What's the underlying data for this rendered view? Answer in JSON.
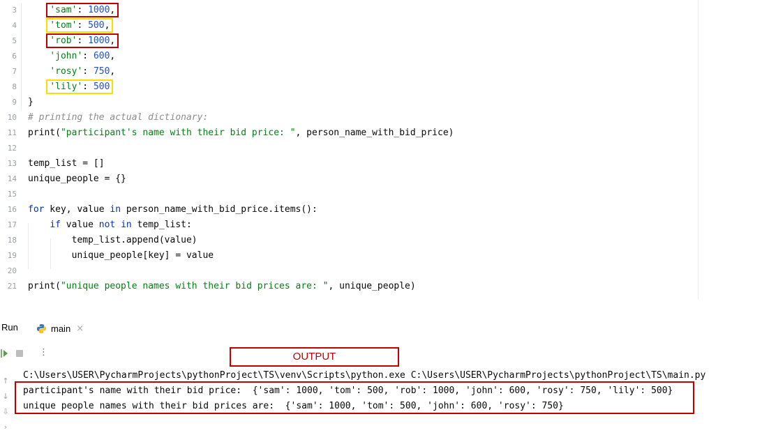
{
  "editor": {
    "line_numbers": [
      "3",
      "4",
      "5",
      "6",
      "7",
      "8",
      "9",
      "10",
      "11",
      "12",
      "13",
      "14",
      "15",
      "16",
      "17",
      "18",
      "19",
      "20",
      "21"
    ],
    "dict_entries": [
      {
        "key": "'sam'",
        "sep": ": ",
        "value": "1000",
        "end": ",",
        "highlight": "red"
      },
      {
        "key": "'tom'",
        "sep": ": ",
        "value": "500",
        "end": ",",
        "highlight": "yellow"
      },
      {
        "key": "'rob'",
        "sep": ": ",
        "value": "1000",
        "end": ",",
        "highlight": "red"
      },
      {
        "key": "'john'",
        "sep": ": ",
        "value": "600",
        "end": ",",
        "highlight": "none"
      },
      {
        "key": "'rosy'",
        "sep": ": ",
        "value": "750",
        "end": ",",
        "highlight": "none"
      },
      {
        "key": "'lily'",
        "sep": ": ",
        "value": "500",
        "end": "",
        "highlight": "yellow"
      }
    ],
    "closing_brace": "}",
    "comment": "# printing the actual dictionary:",
    "print1_fn": "print(",
    "print1_str": "\"participant's name with their bid price: \"",
    "print1_rest": ", person_name_with_bid_price)",
    "temp_list_line": "temp_list = []",
    "unique_people_line": "unique_people = {}",
    "for_kw": "for",
    "for_mid": " key, value ",
    "in_kw": "in",
    "for_rest": " person_name_with_bid_price.items():",
    "if_kw": "if",
    "if_mid": " value ",
    "not_kw": "not",
    "in_kw2": "in",
    "if_rest": " temp_list:",
    "append_line": "temp_list.append(value)",
    "assign_line": "unique_people[key] = value",
    "print2_fn": "print(",
    "print2_str": "\"unique people names with their bid prices are: \"",
    "print2_rest": ", unique_people)"
  },
  "run_panel": {
    "title": "Run",
    "tab_label": "main",
    "tab_close": "×",
    "more_icon": "⋮",
    "output_label": "OUTPUT",
    "console_lines": [
      "C:\\Users\\USER\\PycharmProjects\\pythonProject\\TS\\venv\\Scripts\\python.exe C:\\Users\\USER\\PycharmProjects\\pythonProject\\TS\\main.py",
      "participant's name with their bid price:  {'sam': 1000, 'tom': 500, 'rob': 1000, 'john': 600, 'rosy': 750, 'lily': 500}",
      "unique people names with their bid prices are:  {'sam': 1000, 'tom': 500, 'john': 600, 'rosy': 750}"
    ],
    "side_icons": [
      "↑",
      "↓",
      "⇩",
      "›"
    ]
  },
  "colors": {
    "annotation_red": "#c00000",
    "annotation_yellow": "#f5e100",
    "string": "#067d17",
    "number": "#1750eb",
    "keyword": "#0033b3"
  }
}
